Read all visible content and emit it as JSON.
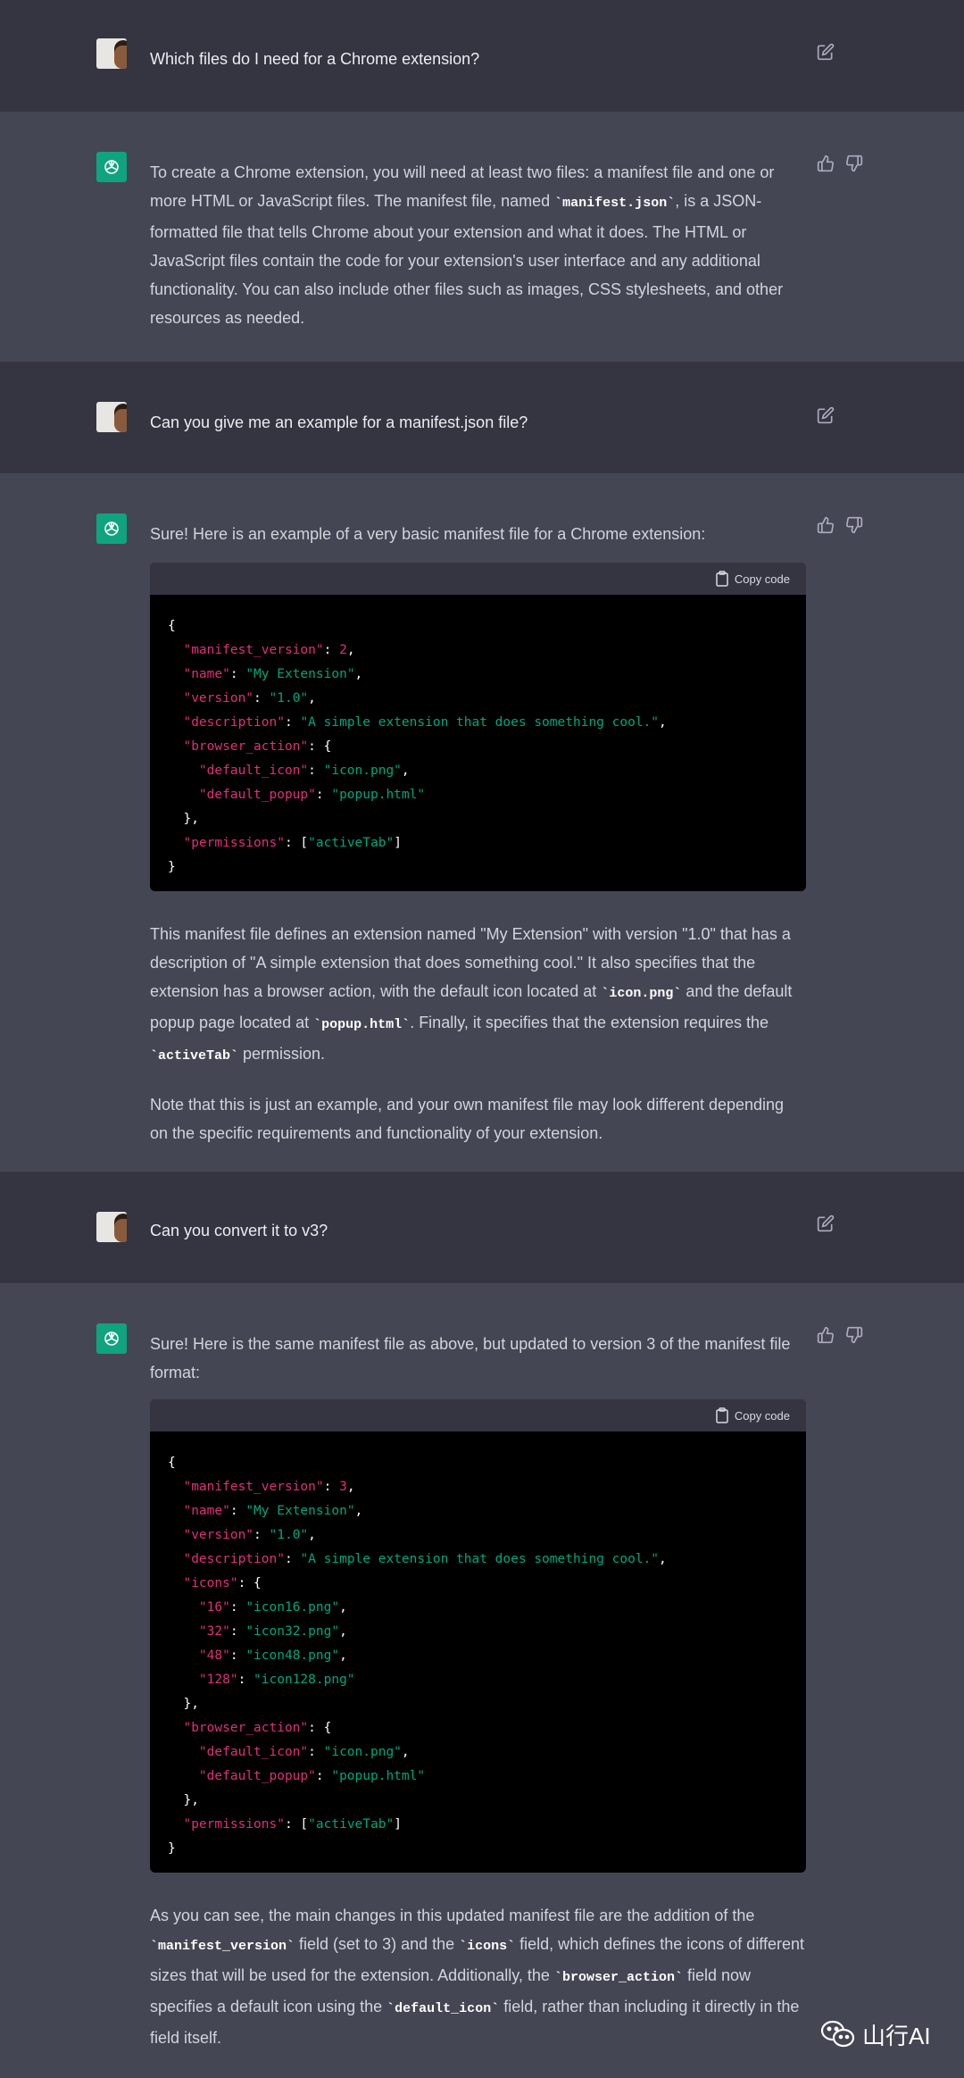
{
  "turns": [
    {
      "role": "user",
      "text": "Which files do I need for a Chrome extension?"
    },
    {
      "role": "assistant",
      "paragraphs": [
        [
          "To create a Chrome extension, you will need at least two files: a manifest file and one or more HTML or JavaScript files. The manifest file, named ",
          {
            "code": "manifest.json"
          },
          ", is a JSON-formatted file that tells Chrome about your extension and what it does. The HTML or JavaScript files contain the code for your extension's user interface and any additional functionality. You can also include other files such as images, CSS stylesheets, and other resources as needed."
        ]
      ]
    },
    {
      "role": "user",
      "text": "Can you give me an example for a manifest.json file?"
    },
    {
      "role": "assistant",
      "intro": "Sure! Here is an example of a very basic manifest file for a Chrome extension:",
      "code_lines": [
        [
          [
            "p",
            "{"
          ]
        ],
        [
          [
            "p",
            "  "
          ],
          [
            "k",
            "\"manifest_version\""
          ],
          [
            "p",
            ": "
          ],
          [
            "n",
            "2"
          ],
          [
            "p",
            ","
          ]
        ],
        [
          [
            "p",
            "  "
          ],
          [
            "k",
            "\"name\""
          ],
          [
            "p",
            ": "
          ],
          [
            "s",
            "\"My Extension\""
          ],
          [
            "p",
            ","
          ]
        ],
        [
          [
            "p",
            "  "
          ],
          [
            "k",
            "\"version\""
          ],
          [
            "p",
            ": "
          ],
          [
            "s",
            "\"1.0\""
          ],
          [
            "p",
            ","
          ]
        ],
        [
          [
            "p",
            "  "
          ],
          [
            "k",
            "\"description\""
          ],
          [
            "p",
            ": "
          ],
          [
            "s",
            "\"A simple extension that does something cool.\""
          ],
          [
            "p",
            ","
          ]
        ],
        [
          [
            "p",
            "  "
          ],
          [
            "k",
            "\"browser_action\""
          ],
          [
            "p",
            ": {"
          ]
        ],
        [
          [
            "p",
            "    "
          ],
          [
            "k",
            "\"default_icon\""
          ],
          [
            "p",
            ": "
          ],
          [
            "s",
            "\"icon.png\""
          ],
          [
            "p",
            ","
          ]
        ],
        [
          [
            "p",
            "    "
          ],
          [
            "k",
            "\"default_popup\""
          ],
          [
            "p",
            ": "
          ],
          [
            "s",
            "\"popup.html\""
          ]
        ],
        [
          [
            "p",
            "  },"
          ]
        ],
        [
          [
            "p",
            "  "
          ],
          [
            "k",
            "\"permissions\""
          ],
          [
            "p",
            ": ["
          ],
          [
            "s",
            "\"activeTab\""
          ],
          [
            "p",
            "]"
          ]
        ],
        [
          [
            "p",
            "}"
          ]
        ]
      ],
      "paragraphs": [
        [
          "This manifest file defines an extension named \"My Extension\" with version \"1.0\" that has a description of \"A simple extension that does something cool.\" It also specifies that the extension has a browser action, with the default icon located at ",
          {
            "code": "icon.png"
          },
          " and the default popup page located at ",
          {
            "code": "popup.html"
          },
          ". Finally, it specifies that the extension requires the ",
          {
            "code": "activeTab"
          },
          " permission."
        ],
        [
          "Note that this is just an example, and your own manifest file may look different depending on the specific requirements and functionality of your extension."
        ]
      ]
    },
    {
      "role": "user",
      "text": "Can you convert it to v3?"
    },
    {
      "role": "assistant",
      "intro": "Sure! Here is the same manifest file as above, but updated to version 3 of the manifest file format:",
      "code_lines": [
        [
          [
            "p",
            "{"
          ]
        ],
        [
          [
            "p",
            "  "
          ],
          [
            "k",
            "\"manifest_version\""
          ],
          [
            "p",
            ": "
          ],
          [
            "n",
            "3"
          ],
          [
            "p",
            ","
          ]
        ],
        [
          [
            "p",
            "  "
          ],
          [
            "k",
            "\"name\""
          ],
          [
            "p",
            ": "
          ],
          [
            "s",
            "\"My Extension\""
          ],
          [
            "p",
            ","
          ]
        ],
        [
          [
            "p",
            "  "
          ],
          [
            "k",
            "\"version\""
          ],
          [
            "p",
            ": "
          ],
          [
            "s",
            "\"1.0\""
          ],
          [
            "p",
            ","
          ]
        ],
        [
          [
            "p",
            "  "
          ],
          [
            "k",
            "\"description\""
          ],
          [
            "p",
            ": "
          ],
          [
            "s",
            "\"A simple extension that does something cool.\""
          ],
          [
            "p",
            ","
          ]
        ],
        [
          [
            "p",
            "  "
          ],
          [
            "k",
            "\"icons\""
          ],
          [
            "p",
            ": {"
          ]
        ],
        [
          [
            "p",
            "    "
          ],
          [
            "k",
            "\"16\""
          ],
          [
            "p",
            ": "
          ],
          [
            "s",
            "\"icon16.png\""
          ],
          [
            "p",
            ","
          ]
        ],
        [
          [
            "p",
            "    "
          ],
          [
            "k",
            "\"32\""
          ],
          [
            "p",
            ": "
          ],
          [
            "s",
            "\"icon32.png\""
          ],
          [
            "p",
            ","
          ]
        ],
        [
          [
            "p",
            "    "
          ],
          [
            "k",
            "\"48\""
          ],
          [
            "p",
            ": "
          ],
          [
            "s",
            "\"icon48.png\""
          ],
          [
            "p",
            ","
          ]
        ],
        [
          [
            "p",
            "    "
          ],
          [
            "k",
            "\"128\""
          ],
          [
            "p",
            ": "
          ],
          [
            "s",
            "\"icon128.png\""
          ]
        ],
        [
          [
            "p",
            "  },"
          ]
        ],
        [
          [
            "p",
            "  "
          ],
          [
            "k",
            "\"browser_action\""
          ],
          [
            "p",
            ": {"
          ]
        ],
        [
          [
            "p",
            "    "
          ],
          [
            "k",
            "\"default_icon\""
          ],
          [
            "p",
            ": "
          ],
          [
            "s",
            "\"icon.png\""
          ],
          [
            "p",
            ","
          ]
        ],
        [
          [
            "p",
            "    "
          ],
          [
            "k",
            "\"default_popup\""
          ],
          [
            "p",
            ": "
          ],
          [
            "s",
            "\"popup.html\""
          ]
        ],
        [
          [
            "p",
            "  },"
          ]
        ],
        [
          [
            "p",
            "  "
          ],
          [
            "k",
            "\"permissions\""
          ],
          [
            "p",
            ": ["
          ],
          [
            "s",
            "\"activeTab\""
          ],
          [
            "p",
            "]"
          ]
        ],
        [
          [
            "p",
            "}"
          ]
        ]
      ],
      "paragraphs": [
        [
          "As you can see, the main changes in this updated manifest file are the addition of the ",
          {
            "code": "manifest_version"
          },
          " field (set to 3) and the ",
          {
            "code": "icons"
          },
          " field, which defines the icons of different sizes that will be used for the extension. Additionally, the ",
          {
            "code": "browser_action"
          },
          " field now specifies a default icon using the ",
          {
            "code": "default_icon"
          },
          " field, rather than including it directly in the field itself."
        ]
      ]
    }
  ],
  "copy_label": "Copy code",
  "watermark": "山行AI",
  "icons": {
    "edit": "edit-icon",
    "thumbs_up": "thumbs-up-icon",
    "thumbs_down": "thumbs-down-icon",
    "copy": "clipboard-icon",
    "bot": "openai-logo-icon",
    "watermark": "wechat-icon"
  },
  "colors": {
    "user_bg": "#343541",
    "assistant_bg": "#444654",
    "code_bg": "#000000",
    "code_key": "#df3079",
    "code_string": "#00a67d",
    "bot_avatar": "#10a37f"
  }
}
